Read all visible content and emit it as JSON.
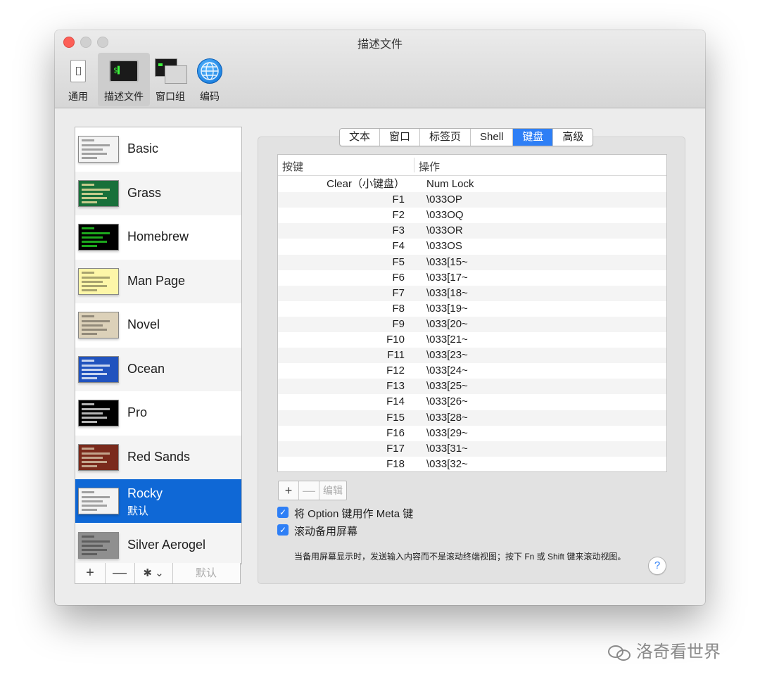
{
  "window": {
    "title": "描述文件"
  },
  "toolbar": {
    "items": [
      {
        "label": "通用",
        "icon": "general-icon"
      },
      {
        "label": "描述文件",
        "icon": "profile-icon",
        "icon_text": "$▌"
      },
      {
        "label": "窗口组",
        "icon": "window-groups-icon"
      },
      {
        "label": "编码",
        "icon": "encoding-globe-icon"
      }
    ]
  },
  "profiles": [
    {
      "name": "Basic",
      "colors": [
        "#f3f3f3",
        "#2a2a2a"
      ]
    },
    {
      "name": "Grass",
      "colors": [
        "#18703a",
        "#ffe9a8"
      ]
    },
    {
      "name": "Homebrew",
      "colors": [
        "#000000",
        "#27e027"
      ]
    },
    {
      "name": "Man Page",
      "colors": [
        "#fdf6a8",
        "#000000"
      ]
    },
    {
      "name": "Novel",
      "colors": [
        "#dcd1b9",
        "#583b27"
      ]
    },
    {
      "name": "Ocean",
      "colors": [
        "#2153be",
        "#ffffff"
      ]
    },
    {
      "name": "Pro",
      "colors": [
        "#000000",
        "#f2f2f2"
      ]
    },
    {
      "name": "Red Sands",
      "colors": [
        "#7a2a1c",
        "#dccdb1"
      ]
    },
    {
      "name": "Rocky",
      "subtitle": "默认",
      "colors": [
        "#f3f3f3",
        "#111111"
      ],
      "selected": true
    },
    {
      "name": "Silver Aerogel",
      "colors": [
        "#8f8f8f",
        "#000000"
      ]
    }
  ],
  "list_buttons": {
    "add": "+",
    "remove": "—",
    "gear": "✱ ⌄",
    "default": "默认"
  },
  "tabs": [
    "文本",
    "窗口",
    "标签页",
    "Shell",
    "键盘",
    "高级"
  ],
  "active_tab": "键盘",
  "key_table": {
    "headers": {
      "key": "按键",
      "action": "操作"
    },
    "rows": [
      {
        "key": "Clear（小键盘）",
        "action": "Num Lock"
      },
      {
        "key": "F1",
        "action": "\\033OP"
      },
      {
        "key": "F2",
        "action": "\\033OQ"
      },
      {
        "key": "F3",
        "action": "\\033OR"
      },
      {
        "key": "F4",
        "action": "\\033OS"
      },
      {
        "key": "F5",
        "action": "\\033[15~"
      },
      {
        "key": "F6",
        "action": "\\033[17~"
      },
      {
        "key": "F7",
        "action": "\\033[18~"
      },
      {
        "key": "F8",
        "action": "\\033[19~"
      },
      {
        "key": "F9",
        "action": "\\033[20~"
      },
      {
        "key": "F10",
        "action": "\\033[21~"
      },
      {
        "key": "F11",
        "action": "\\033[23~"
      },
      {
        "key": "F12",
        "action": "\\033[24~"
      },
      {
        "key": "F13",
        "action": "\\033[25~"
      },
      {
        "key": "F14",
        "action": "\\033[26~"
      },
      {
        "key": "F15",
        "action": "\\033[28~"
      },
      {
        "key": "F16",
        "action": "\\033[29~"
      },
      {
        "key": "F17",
        "action": "\\033[31~"
      },
      {
        "key": "F18",
        "action": "\\033[32~"
      }
    ]
  },
  "table_buttons": {
    "add": "+",
    "remove": "—",
    "edit": "编辑"
  },
  "options": {
    "option_as_meta": {
      "label": "将 Option 键用作 Meta 键",
      "checked": true
    },
    "scroll_alternate": {
      "label": "滚动备用屏幕",
      "checked": true
    },
    "description": "当备用屏幕显示时，发送输入内容而不是滚动终端视图；按下 Fn 或 Shift 键来滚动视图。"
  },
  "help": "?",
  "checkmark": "✓",
  "watermark": "洛奇看世界",
  "accent_color": "#2e7ff6",
  "selection_color": "#0f68d6"
}
